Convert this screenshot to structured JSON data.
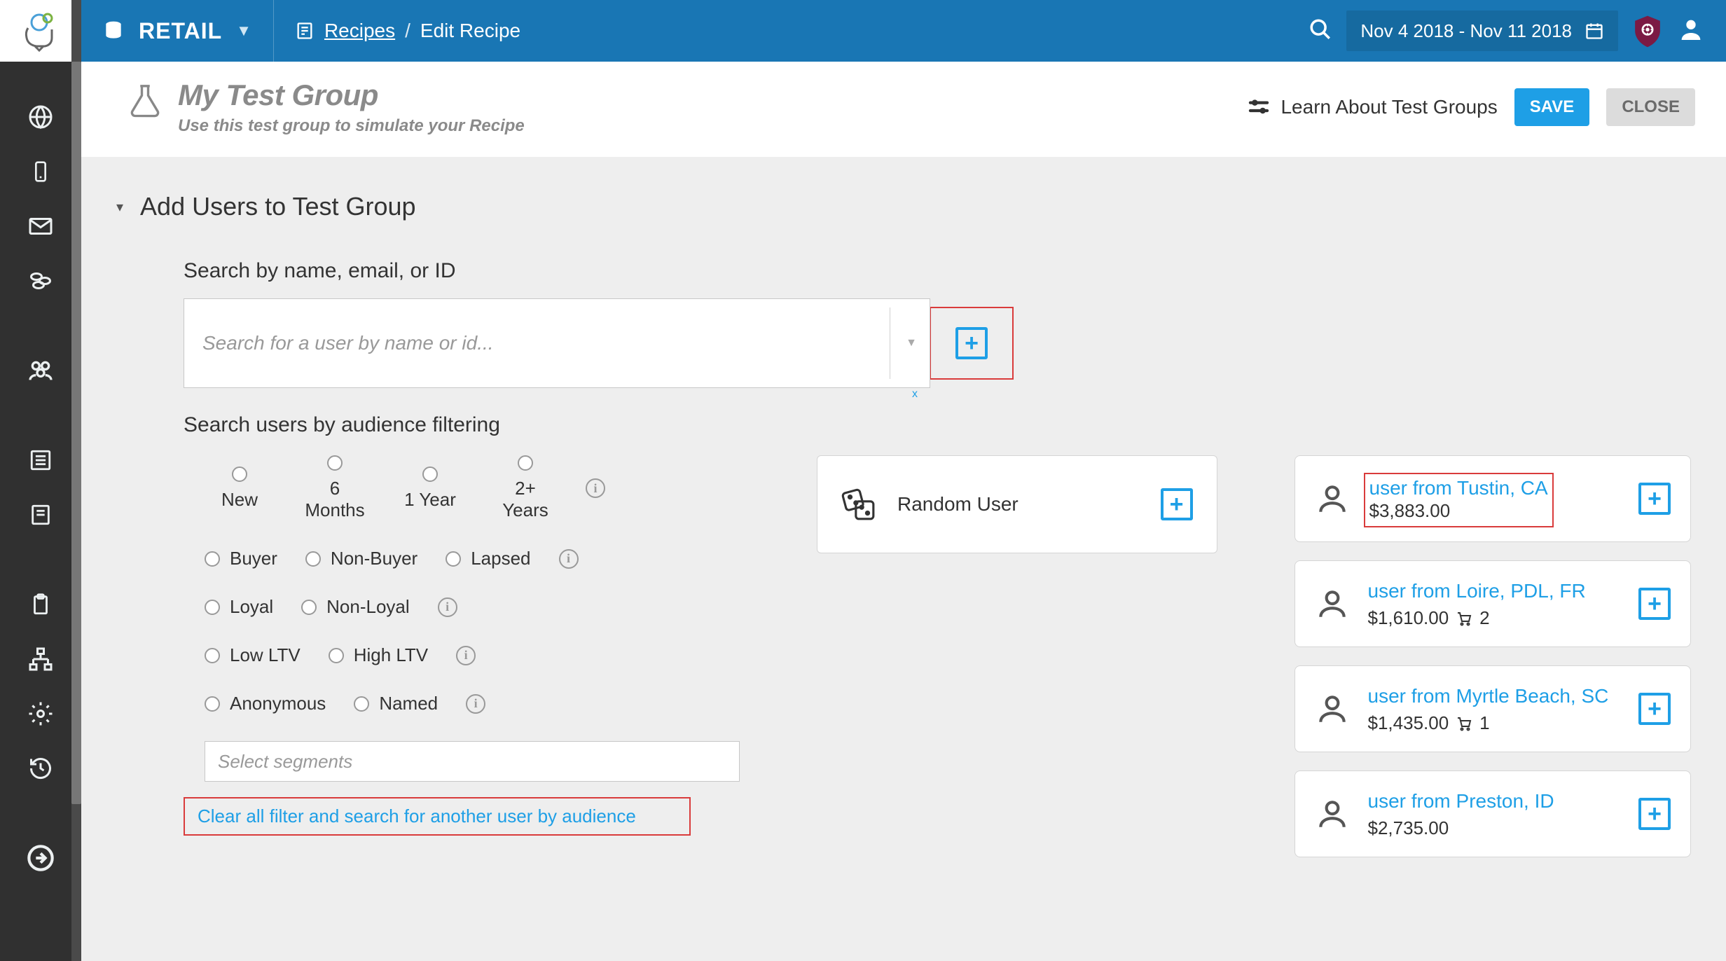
{
  "brand": "RETAIL",
  "breadcrumb": {
    "link": "Recipes",
    "sep": "/",
    "current": "Edit Recipe"
  },
  "date_range": "Nov 4 2018 - Nov 11 2018",
  "page": {
    "title": "My Test Group",
    "subtitle": "Use this test group to simulate your Recipe",
    "learn": "Learn About Test Groups",
    "save": "SAVE",
    "close": "CLOSE"
  },
  "section": {
    "title": "Add Users to Test Group",
    "search_label": "Search by name, email, or ID",
    "search_placeholder": "Search for a user by name or id...",
    "filter_label": "Search users by audience filtering",
    "segments_placeholder": "Select segments",
    "clear_link": "Clear all filter and search for another user by audience"
  },
  "filters": {
    "tenure": [
      "New",
      "6 Months",
      "1 Year",
      "2+ Years"
    ],
    "row2": [
      "Buyer",
      "Non-Buyer",
      "Lapsed"
    ],
    "row3": [
      "Loyal",
      "Non-Loyal"
    ],
    "row4": [
      "Low LTV",
      "High LTV"
    ],
    "row5": [
      "Anonymous",
      "Named"
    ]
  },
  "random_user_label": "Random User",
  "users": [
    {
      "name": "user from Tustin, CA",
      "amount": "$3,883.00",
      "cart": ""
    },
    {
      "name": "user from Loire, PDL, FR",
      "amount": "$1,610.00",
      "cart": "2"
    },
    {
      "name": "user from Myrtle Beach, SC",
      "amount": "$1,435.00",
      "cart": "1"
    },
    {
      "name": "user from Preston, ID",
      "amount": "$2,735.00",
      "cart": ""
    }
  ],
  "tiny_x": "x"
}
